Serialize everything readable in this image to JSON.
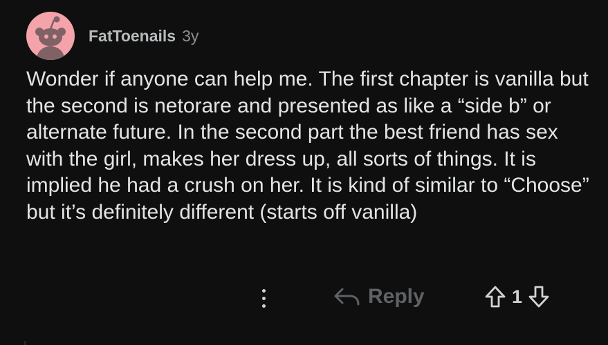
{
  "comment": {
    "author": "FatToenails",
    "age": "3y",
    "text": "Wonder if anyone can help me. The first chapter is vanilla but the second is netorare and presented as like a “side b” or alternate future. In the second part the best friend has sex with the girl, makes her dress up, all sorts of things. It is implied he had a crush on her. It is kind of similar to “Choose” but it’s definitely different (starts off vanilla)",
    "avatar_color": "#f5a3aa"
  },
  "actions": {
    "more_icon": "more-vertical-icon",
    "reply_icon": "reply-arrow-icon",
    "reply_label": "Reply",
    "upvote_icon": "upvote-arrow-icon",
    "vote_count": "1",
    "downvote_icon": "downvote-arrow-icon"
  },
  "colors": {
    "background": "#0f0f0f",
    "text": "#e2e4e6",
    "muted": "#8c8f92",
    "reply_muted": "#5e6265"
  }
}
